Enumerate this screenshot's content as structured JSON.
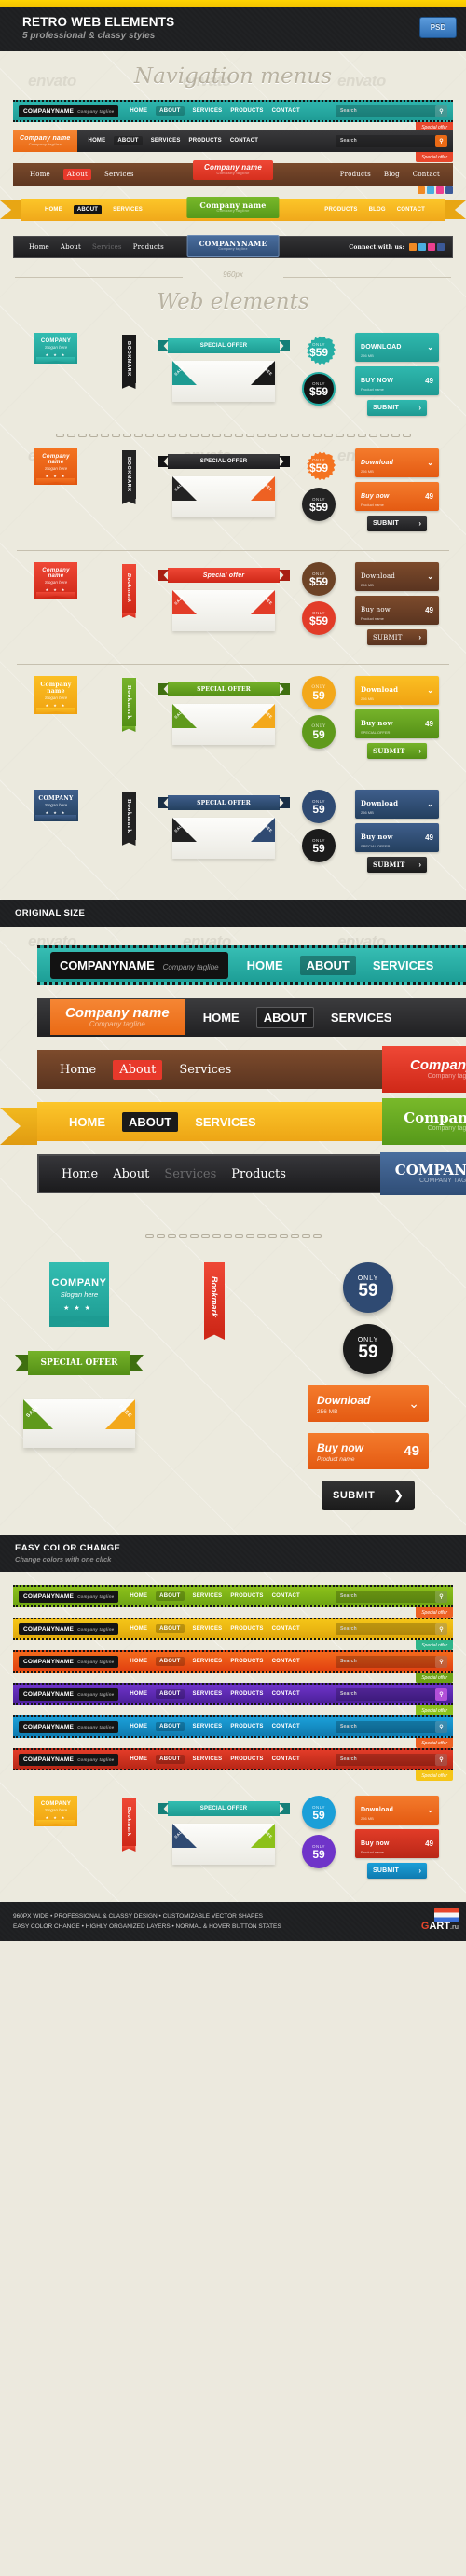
{
  "hero": {
    "title": "RETRO WEB ELEMENTS",
    "subtitle": "5 professional & classy styles",
    "badge": "PSD"
  },
  "watermark": "envato",
  "sections": {
    "nav_title": "Navigation menus",
    "web_title": "Web elements",
    "original_size": {
      "title": "ORIGINAL SIZE",
      "subtitle": ""
    },
    "easy_color": {
      "title": "EASY COLOR CHANGE",
      "subtitle": "Change colors with one click"
    }
  },
  "measure_label": "960px",
  "nav_common": {
    "company_name": "COMPANYNAME",
    "company_tagline": "Company tagline",
    "company_name_script": "Company name",
    "items": [
      "HOME",
      "ABOUT",
      "SERVICES",
      "PRODUCTS",
      "CONTACT"
    ],
    "items_serif": [
      "Home",
      "About",
      "Services",
      "Products",
      "Blog",
      "Contact"
    ],
    "active_item": "ABOUT",
    "search_placeholder": "Search",
    "search_icon": "search-icon",
    "special_offer_tab": "Special offer",
    "connect_label": "Connect with us:",
    "social_icons": [
      "rss-icon",
      "twitter-icon",
      "flickr-icon",
      "facebook-icon"
    ],
    "social_colors": [
      "#f08a24",
      "#4aaee0",
      "#ec3f8f",
      "#3b5998"
    ]
  },
  "nav_menus": [
    {
      "name": "teal-nav",
      "style": "teal",
      "logo_style": "chip"
    },
    {
      "name": "orange-dark-nav",
      "style": "dark",
      "logo_style": "orange"
    },
    {
      "name": "wood-nav",
      "style": "wood",
      "logo_style": "center-red",
      "items": [
        "Home",
        "About",
        "Services"
      ],
      "items_right": [
        "Products",
        "Blog",
        "Contact"
      ],
      "center_color": "#e8392b"
    },
    {
      "name": "gold-ribbon-nav",
      "style": "gold",
      "logo_style": "center-green",
      "items": [
        "HOME",
        "ABOUT",
        "SERVICES"
      ],
      "items_right": [
        "PRODUCTS",
        "BLOG",
        "CONTACT"
      ],
      "center_color": "#65a81e"
    },
    {
      "name": "black-blue-nav",
      "style": "black2",
      "logo_style": "center-blue",
      "items": [
        "Home",
        "About",
        "Services",
        "Products"
      ],
      "center_color": "#3d618f"
    }
  ],
  "elements": {
    "company_badge": {
      "title": "COMPANY",
      "slogan": "Slogan here",
      "stars": "★ ★ ★"
    },
    "bookmark_label": "BOOKMARK",
    "bookmark_label_alt": "Bookmark",
    "special_offer": "SPECIAL OFFER",
    "special_offer_script": "Special offer",
    "corner_left": "SALE",
    "corner_right": "FREE",
    "seal": {
      "only": "ONLY",
      "amount": "$59",
      "amount_alt": "59",
      "cents": "$"
    },
    "buttons": {
      "download": {
        "label": "DOWNLOAD",
        "sub": "256 MB",
        "icon": "double-chevron-down-icon"
      },
      "download_alt": {
        "label": "Download",
        "sub": "256 MB"
      },
      "buynow": {
        "label": "BUY NOW",
        "sub": "Product name",
        "price": "49",
        "cents": "$"
      },
      "buynow_alt": {
        "label": "Buy now",
        "sub": "SPECIAL OFFER",
        "price": "49",
        "cents": "$"
      },
      "submit": {
        "label": "SUBMIT",
        "icon": "chevron-right-icon"
      }
    }
  },
  "element_rows": [
    {
      "name": "teal-set",
      "main": "#25aea4",
      "dark": "#1a1a1a",
      "accent": "#25aea4",
      "seal2": "#141414",
      "btn": "#25aea4",
      "btn3": "#25aea4"
    },
    {
      "name": "orange-set",
      "main": "#ee6123",
      "dark": "#232323",
      "accent": "#ee6123",
      "seal2": "#232323",
      "btn": "#ee6123",
      "btn3": "#232323"
    },
    {
      "name": "red-set",
      "main": "#e23c28",
      "dark": "#e23c28",
      "accent": "#e23c28",
      "seal2": "#e23c28",
      "btn": "#6d4326",
      "btn3": "#6d4326"
    },
    {
      "name": "green-set",
      "main": "#f3a81b",
      "dark": "#5f9a1c",
      "accent": "#5f9a1c",
      "seal2": "#5f9a1c",
      "btn": "#f3a81b",
      "btn3": "#5f9a1c"
    },
    {
      "name": "blue-set",
      "main": "#2f4a72",
      "dark": "#222222",
      "accent": "#2f4a72",
      "seal2": "#1b1b1b",
      "btn": "#2f4a72",
      "btn3": "#222222"
    }
  ],
  "original_bars": [
    {
      "name": "teal-bar",
      "style": "teal",
      "logo": "COMPANYNAME",
      "tagline": "Company tagline",
      "items": [
        "HOME",
        "ABOUT",
        "SERVICES"
      ]
    },
    {
      "name": "orange-bar",
      "style": "dark",
      "logo": "Company name",
      "tagline": "Company tagline",
      "items": [
        "HOME",
        "ABOUT",
        "SERVICES"
      ]
    },
    {
      "name": "wood-bar",
      "style": "wood",
      "logo": "Company na",
      "tagline": "Company tagline",
      "items": [
        "Home",
        "About",
        "Services"
      ]
    },
    {
      "name": "gold-bar",
      "style": "gold",
      "logo": "Company na",
      "tagline": "Company tagline",
      "items": [
        "HOME",
        "ABOUT",
        "SERVICES"
      ]
    },
    {
      "name": "black-bar",
      "style": "blk",
      "logo": "COMPANY NA",
      "tagline": "COMPANY TAGLINE",
      "items": [
        "Home",
        "About",
        "Services",
        "Products"
      ]
    }
  ],
  "original_elements": {
    "company": "COMPANY",
    "slogan": "Slogan here",
    "bookmark": "Bookmark",
    "only": "ONLY",
    "price": "59",
    "cents": "$",
    "special_offer": "SPECIAL OFFER",
    "download": "Download",
    "download_size": "256 MB",
    "sale": "SALE",
    "free": "FREE",
    "buynow": "Buy now",
    "product_name": "Product name",
    "buy_price": "49",
    "submit": "SUBMIT"
  },
  "color_rows": [
    {
      "name": "green-row",
      "color1": "#8cc11a",
      "color2": "#6ea414",
      "tab": "#ee6123"
    },
    {
      "name": "yellow-row",
      "color1": "#f5c518",
      "color2": "#e0a90c",
      "tab": "#2fb58a"
    },
    {
      "name": "orange-row",
      "color1": "#f36a1c",
      "color2": "#e24110",
      "tab": "#6ea414"
    },
    {
      "name": "purple-row",
      "color1": "#6f34c9",
      "color2": "#4b1f99",
      "tab": "#8cc11a"
    },
    {
      "name": "blue-row",
      "color1": "#1b9fd8",
      "color2": "#0f7bb0",
      "tab": "#ee6123"
    },
    {
      "name": "red-row",
      "color1": "#e23c28",
      "color2": "#b92717",
      "tab": "#f5c518"
    }
  ],
  "footer": {
    "line1_pre": "960PX WIDE",
    "line1": "960PX WIDE • PROFESSIONAL & CLASSY DESIGN • CUSTOMIZABLE VECTOR SHAPES",
    "line2": "EASY COLOR CHANGE • HIGHLY ORGANIZED LAYERS • NORMAL & HOVER BUTTON STATES",
    "brand_g": "G",
    "brand_art": "ART",
    "brand_ru": ".ru"
  }
}
